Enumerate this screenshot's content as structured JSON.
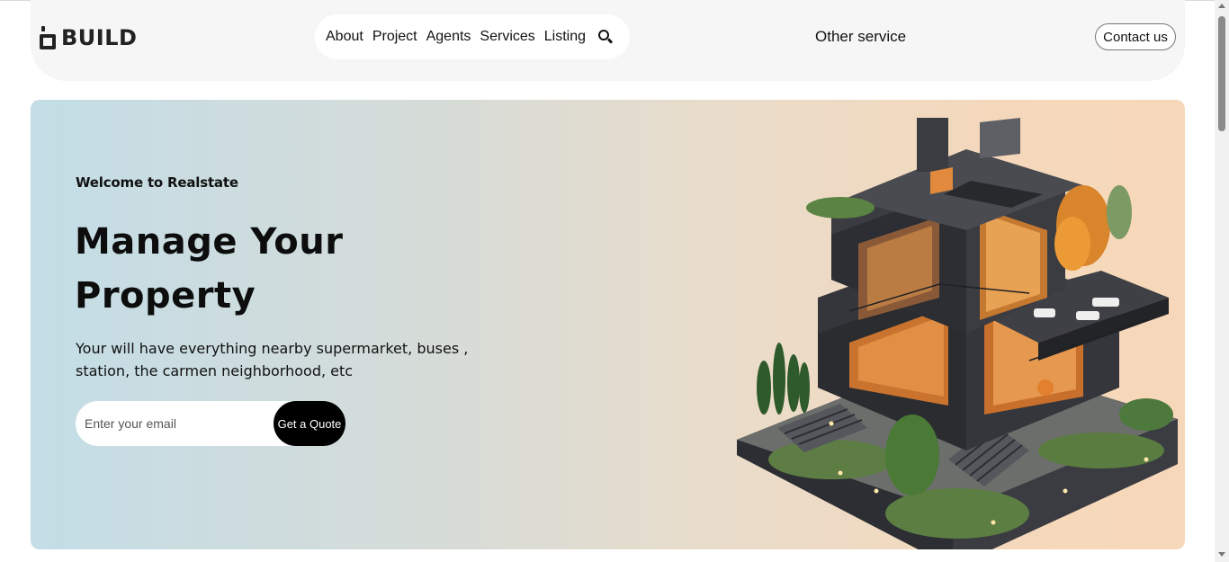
{
  "header": {
    "logo_text": "BUILD",
    "nav": [
      "About",
      "Project",
      "Agents",
      "Services",
      "Listing"
    ],
    "search_icon": "search-icon",
    "other_service": "Other service",
    "contact_label": "Contact us"
  },
  "hero": {
    "welcome": "Welcome to Realstate",
    "headline_line1": "Manage Your",
    "headline_line2": "Property",
    "subtext": "Your will have everything nearby supermarket, buses , station, the carmen neighborhood, etc",
    "email_placeholder": "Enter your email",
    "quote_label": "Get a Quote"
  },
  "colors": {
    "hero_gradient_start": "#c3dde6",
    "hero_gradient_end": "#f7d7b9",
    "button_dark": "#000000",
    "header_bg": "#f6f6f6"
  }
}
